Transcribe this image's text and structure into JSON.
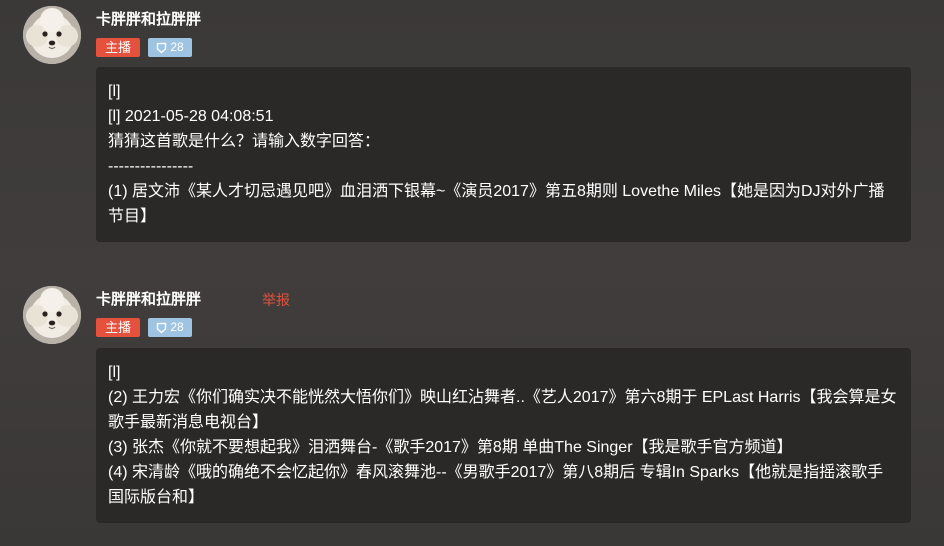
{
  "messages": [
    {
      "username": "卡胖胖和拉胖胖",
      "badge_host": "主播",
      "badge_level": "28",
      "report": "",
      "lines": [
        "[l]",
        "[l] 2021-05-28 04:08:51",
        "猜猜这首歌是什么？请输入数字回答：",
        "----------------",
        "(1) 居文沛《某人才切忌遇见吧》血泪洒下银幕~《演员2017》第五8期则 Lovethe Miles【她是因为DJ对外广播节目】"
      ]
    },
    {
      "username": "卡胖胖和拉胖胖",
      "badge_host": "主播",
      "badge_level": "28",
      "report": "举报",
      "lines": [
        "[l]",
        "(2) 王力宏《你们确实决不能恍然大悟你们》映山红沾舞者..《艺人2017》第六8期于 EPLast Harris【我会算是女歌手最新消息电视台】",
        "(3) 张杰《你就不要想起我》泪洒舞台-《歌手2017》第8期 单曲The Singer【我是歌手官方频道】",
        "(4) 宋清龄《哦的确绝不会忆起你》春风滚舞池--《男歌手2017》第八8期后 专辑In Sparks【他就是指摇滚歌手国际版台和】"
      ]
    }
  ],
  "icons": {
    "level_badge": "shield-icon",
    "avatar": "dog-avatar"
  },
  "colors": {
    "host_badge": "#e4513d",
    "level_badge": "#9fc4e2",
    "report": "#e0523f",
    "bubble": "#2a2928"
  }
}
